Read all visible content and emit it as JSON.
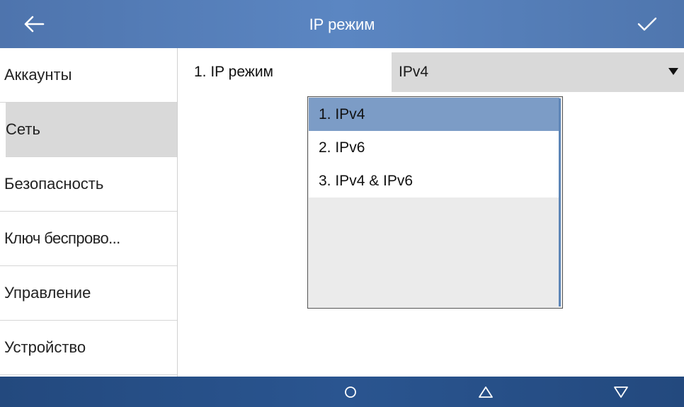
{
  "header": {
    "title": "IP режим",
    "back_icon": "arrow-left-icon",
    "confirm_icon": "checkmark-icon"
  },
  "sidebar": {
    "items": [
      {
        "label": "Аккаунты"
      },
      {
        "label": "Сеть"
      },
      {
        "label": "Безопасность"
      },
      {
        "label": "Ключ беспрово..."
      },
      {
        "label": "Управление"
      },
      {
        "label": "Устройство"
      }
    ],
    "active_index": 1
  },
  "main": {
    "field_label": "1. IP режим",
    "field_value": "IPv4"
  },
  "dropdown": {
    "options": [
      {
        "label": "1. IPv4"
      },
      {
        "label": "2. IPv6"
      },
      {
        "label": "3. IPv4 & IPv6"
      }
    ],
    "selected_index": 0
  },
  "bottom_nav": {
    "icons": [
      "circle-icon",
      "triangle-up-icon",
      "triangle-down-icon"
    ]
  },
  "colors": {
    "header_bg": "#5b86c2",
    "footer_bg": "#2a5590",
    "selected_option_bg": "#7c9cc6",
    "active_sidebar_bg": "#d9d9d9"
  }
}
